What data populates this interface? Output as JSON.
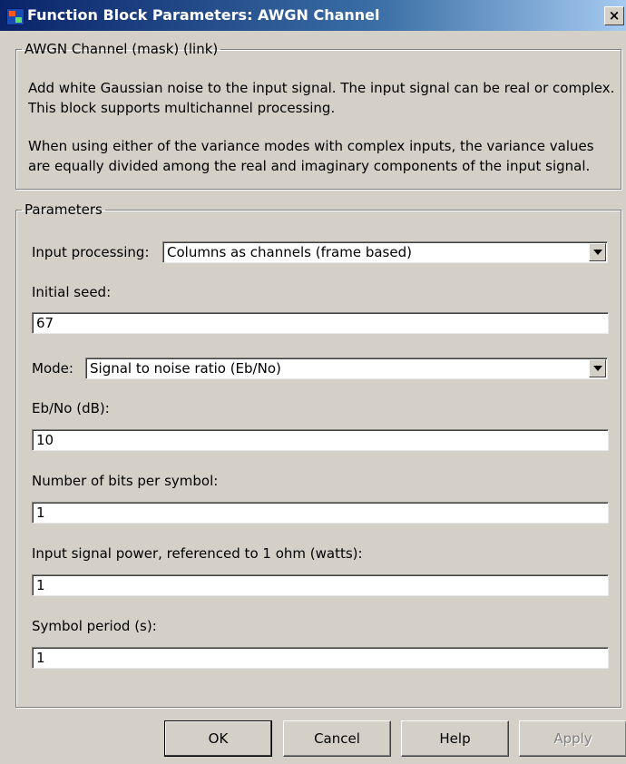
{
  "window": {
    "title": "Function Block Parameters: AWGN Channel",
    "close_label": "×"
  },
  "mask_group": {
    "legend": "AWGN Channel (mask) (link)",
    "description_1": "Add white Gaussian noise to the input signal. The input signal can be real or complex. This block supports multichannel processing.",
    "description_2": "When using either of the variance modes with complex inputs, the variance values are equally divided among the real and imaginary components of the input signal."
  },
  "parameters": {
    "legend": "Parameters",
    "input_processing": {
      "label": "Input processing:",
      "value": "Columns as channels (frame based)"
    },
    "initial_seed": {
      "label": "Initial seed:",
      "value": "67"
    },
    "mode": {
      "label": "Mode:",
      "value": "Signal to noise ratio  (Eb/No)"
    },
    "ebno": {
      "label": "Eb/No (dB):",
      "value": "10"
    },
    "bits_per_symbol": {
      "label": "Number of bits per symbol:",
      "value": "1"
    },
    "signal_power": {
      "label": "Input signal power, referenced to 1 ohm (watts):",
      "value": "1"
    },
    "symbol_period": {
      "label": "Symbol period (s):",
      "value": "1"
    }
  },
  "buttons": {
    "ok": "OK",
    "cancel": "Cancel",
    "help": "Help",
    "apply": "Apply"
  }
}
